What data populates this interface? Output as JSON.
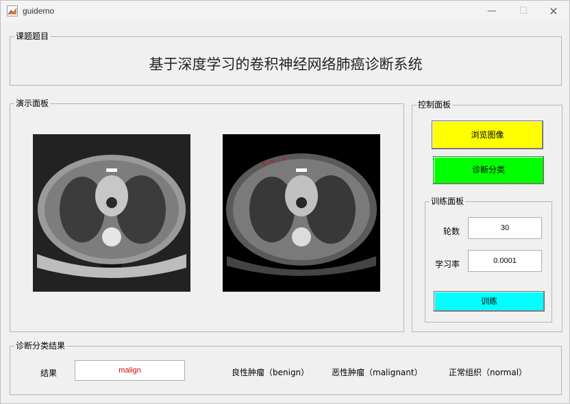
{
  "window": {
    "title": "guidemo",
    "icon": "matlab-figure-icon",
    "minimize": "—",
    "maximize": "☐",
    "close": "✕"
  },
  "topic_panel": {
    "title": "课题题目",
    "text": "基于深度学习的卷积神经网络肺癌诊断系统"
  },
  "demo_panel": {
    "title": "演示面板",
    "image_left": "ct-scan-original",
    "image_right": "ct-scan-segmented"
  },
  "control_panel": {
    "title": "控制面板",
    "browse_button": {
      "label": "浏览图像",
      "color": "#ffff00"
    },
    "diagnose_button": {
      "label": "诊断分类",
      "color": "#00ff00"
    },
    "train_panel": {
      "title": "训练面板",
      "epochs_label": "轮数",
      "epochs_value": "30",
      "lr_label": "学习率",
      "lr_value": "0.0001",
      "train_button": {
        "label": "训练",
        "color": "#00ffff"
      }
    }
  },
  "result_panel": {
    "title": "诊断分类结果",
    "result_label": "结果",
    "result_value": "malign",
    "result_color": "#d00000",
    "classes": [
      "良性肿瘤（benign）",
      "恶性肿瘤（malignant）",
      "正常组织（normal）"
    ]
  }
}
